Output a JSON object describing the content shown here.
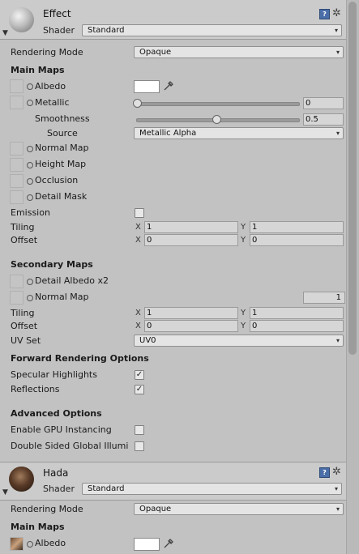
{
  "materials": [
    {
      "name": "Effect",
      "shader_label": "Shader",
      "shader_value": "Standard",
      "rendering_mode_label": "Rendering Mode",
      "rendering_mode_value": "Opaque",
      "main_maps_title": "Main Maps",
      "albedo_label": "Albedo",
      "metallic_label": "Metallic",
      "metallic_value": "0",
      "smoothness_label": "Smoothness",
      "smoothness_value": "0.5",
      "source_label": "Source",
      "source_value": "Metallic Alpha",
      "normal_map_label": "Normal Map",
      "height_map_label": "Height Map",
      "occlusion_label": "Occlusion",
      "detail_mask_label": "Detail Mask",
      "emission_label": "Emission",
      "tiling_label": "Tiling",
      "tiling_x": "1",
      "tiling_y": "1",
      "offset_label": "Offset",
      "offset_x": "0",
      "offset_y": "0",
      "secondary_maps_title": "Secondary Maps",
      "detail_albedo_label": "Detail Albedo x2",
      "sec_normal_map_label": "Normal Map",
      "sec_normal_value": "1",
      "sec_tiling_label": "Tiling",
      "sec_tiling_x": "1",
      "sec_tiling_y": "1",
      "sec_offset_label": "Offset",
      "sec_offset_x": "0",
      "sec_offset_y": "0",
      "uv_set_label": "UV Set",
      "uv_set_value": "UV0",
      "forward_title": "Forward Rendering Options",
      "specular_label": "Specular Highlights",
      "specular_checked": true,
      "reflections_label": "Reflections",
      "reflections_checked": true,
      "advanced_title": "Advanced Options",
      "gpu_instancing_label": "Enable GPU Instancing",
      "gpu_instancing_checked": false,
      "double_sided_label": "Double Sided Global Illumi",
      "double_sided_checked": false
    },
    {
      "name": "Hada",
      "shader_label": "Shader",
      "shader_value": "Standard",
      "rendering_mode_label": "Rendering Mode",
      "rendering_mode_value": "Opaque",
      "main_maps_title": "Main Maps",
      "albedo_label": "Albedo"
    }
  ],
  "symbols": {
    "x_axis": "X",
    "y_axis": "Y",
    "dropdown_arrow": "▾",
    "checkmark": "✓",
    "help": "?",
    "gear": "✲",
    "fold": "▼"
  },
  "colors": {
    "panel_bg": "#c2c2c2",
    "header_bg": "#cbcbcb",
    "albedo_color": "#ffffff",
    "help_icon": "#4a6ea8"
  }
}
